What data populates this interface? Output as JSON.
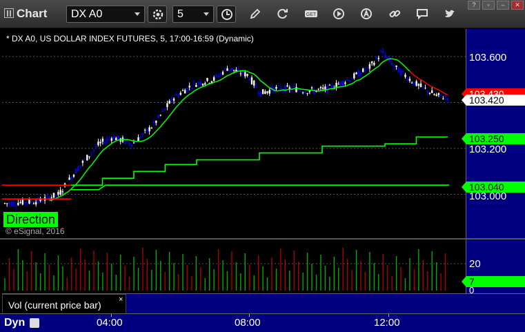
{
  "toolbar": {
    "app_title": "Chart",
    "symbol": "DX A0",
    "interval": "5",
    "buttons": [
      "settings-icon",
      "clock-icon",
      "pencil-icon",
      "refresh-icon",
      "get-icon",
      "play-icon",
      "alert-icon",
      "link-icon",
      "message-icon",
      "twitter-icon"
    ],
    "get_label": "GET",
    "window_controls": [
      "?",
      "▫",
      "–",
      "✕"
    ]
  },
  "chart": {
    "header": "* DX A0, US DOLLAR INDEX FUTURES, 5, 17:00-16:59 (Dynamic)",
    "copyright": "© eSignal, 2016",
    "direction_label": "Direction",
    "price_axis": [
      "103.600",
      "103.200",
      "103.000"
    ],
    "price_tags": {
      "red": "103.430",
      "current": "103.420",
      "green_upper": "103.250",
      "green_lower": "103.040"
    },
    "vol_axis": [
      "20",
      "0"
    ],
    "vol_tag": "7",
    "vol_label": "Vol (current price bar)",
    "vol_close": "×",
    "dyn_label": "Dyn",
    "time_ticks": [
      "04:00",
      "08:00",
      "12:00"
    ],
    "colors": {
      "up_bar": "#ffffff",
      "down_bar": "#0000ff",
      "ma_green": "#00ff00",
      "ma_red": "#ff0000",
      "axis_bg": "#000080",
      "vol_up": "#00aa00",
      "vol_down": "#aa0000"
    }
  },
  "chart_data": {
    "type": "line",
    "title": "DX A0, US DOLLAR INDEX FUTURES, 5, 17:00-16:59 (Dynamic)",
    "ylim": [
      102.8,
      103.78
    ],
    "x_ticks": [
      "04:00",
      "08:00",
      "12:00"
    ],
    "grid": true,
    "series": [
      {
        "type": "step",
        "color": "#00ff00",
        "values": [
          103.04,
          103.07,
          103.1,
          103.13,
          103.15,
          103.15,
          103.18,
          103.18,
          103.21,
          103.21,
          103.22,
          103.25
        ]
      },
      {
        "type": "step",
        "color": "#00ff00",
        "values": [
          103.04,
          103.04,
          103.04
        ]
      },
      {
        "type": "line",
        "color": "#ff0000",
        "values": [
          103.04,
          103.04
        ]
      }
    ],
    "close": 103.42,
    "volume_axis": [
      0,
      20
    ]
  }
}
